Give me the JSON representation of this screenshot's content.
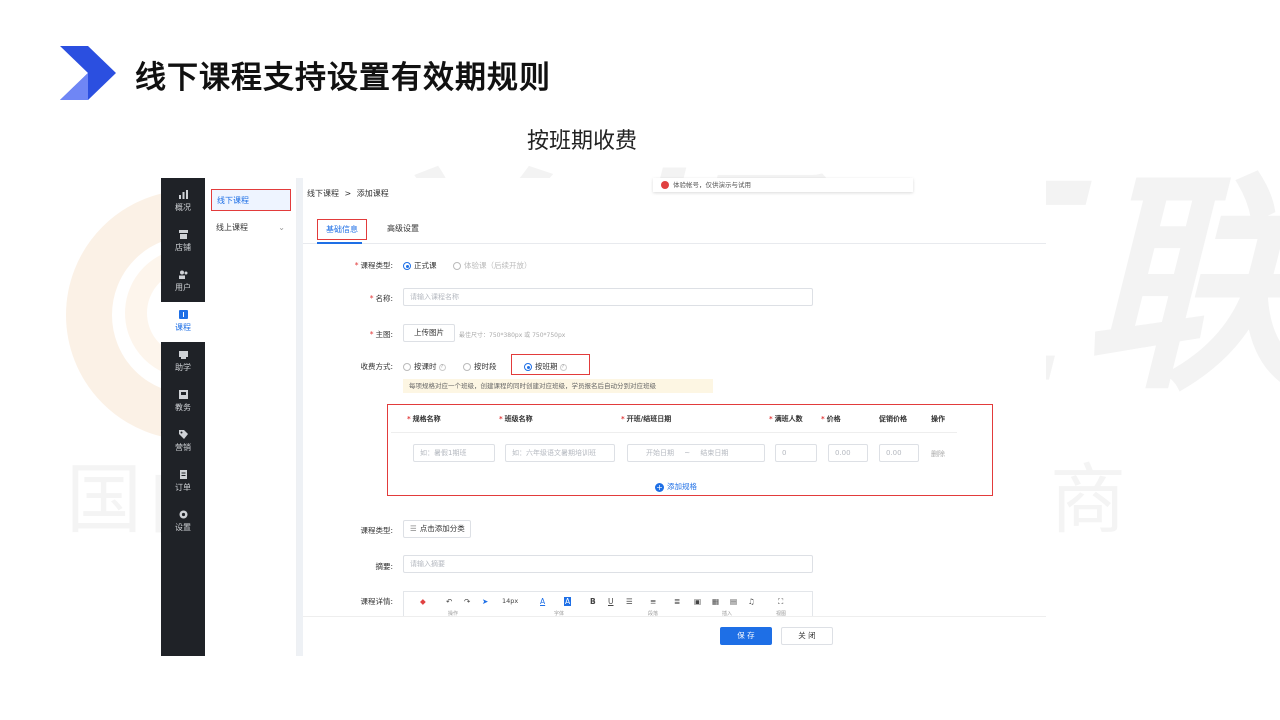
{
  "slide": {
    "title": "线下课程支持设置有效期规则",
    "subtitle": "按班期收费",
    "watermark_brand": "美橘互联",
    "watermark_slogan": "国内领先的数字化营销服务商"
  },
  "colors": {
    "primary": "#1e6fe6",
    "highlight": "#e23b3b",
    "nav_bg": "#1f2227"
  },
  "nav": {
    "items": [
      {
        "label": "概况",
        "icon": "chart-icon"
      },
      {
        "label": "店铺",
        "icon": "store-icon"
      },
      {
        "label": "用户",
        "icon": "users-icon"
      },
      {
        "label": "课程",
        "icon": "course-icon",
        "active": true
      },
      {
        "label": "助学",
        "icon": "study-icon"
      },
      {
        "label": "教务",
        "icon": "admin-icon"
      },
      {
        "label": "营销",
        "icon": "tag-icon"
      },
      {
        "label": "订单",
        "icon": "order-icon"
      },
      {
        "label": "设置",
        "icon": "gear-icon"
      }
    ]
  },
  "subnav": {
    "offline": "线下课程",
    "online": "线上课程"
  },
  "breadcrumb": {
    "parent": "线下课程",
    "sep": ">",
    "current": "添加课程"
  },
  "notice": "体验帐号，仅供演示与试用",
  "tabs": {
    "basic": "基础信息",
    "advanced": "高级设置"
  },
  "form": {
    "type_label": "课程类型:",
    "type_formal": "正式课",
    "type_trial": "体验课（后续开放）",
    "name_label": "名称:",
    "name_placeholder": "请输入课程名称",
    "image_label": "主图:",
    "upload_label": "上传图片",
    "image_hint": "最佳尺寸：750*380px 或 750*750px",
    "charge_label": "收费方式:",
    "charge_by_lesson": "按课时",
    "charge_by_period": "按时段",
    "charge_by_class": "按班期",
    "class_tip": "每项规格对应一个班级，创建课程的同时创建对应班级，学员报名后自动分到对应班级",
    "table": {
      "headers": [
        "规格名称",
        "班级名称",
        "开班/结班日期",
        "满班人数",
        "价格",
        "促销价格",
        "操作"
      ],
      "row": {
        "spec_placeholder": "如：暑假1期班",
        "class_placeholder": "如：六年级语文暑期培训班",
        "start_placeholder": "开始日期",
        "range_sep": "~",
        "end_placeholder": "结束日期",
        "capacity": "0",
        "price": "0.00",
        "promo": "0.00",
        "delete": "删除"
      },
      "add_spec": "添加规格"
    },
    "category_label": "课程类型:",
    "category_button": "点击添加分类",
    "summary_label": "摘要:",
    "summary_placeholder": "请输入摘要",
    "detail_label": "课程详情:",
    "editor": {
      "font_size": "14px",
      "sub_labels": [
        "操作",
        "字体",
        "段落",
        "插入",
        "视图"
      ]
    }
  },
  "footer": {
    "save": "保 存",
    "close": "关 闭"
  }
}
